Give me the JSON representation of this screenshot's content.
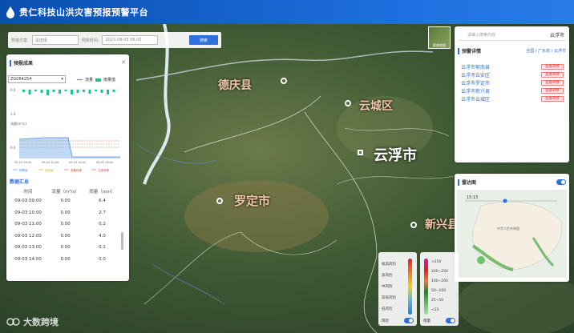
{
  "header": {
    "title": "贵仁科技山洪灾害预报预警平台"
  },
  "search": {
    "field1_label": "预报方案:",
    "field1_value": "请选择",
    "field2_label": "预报时间:",
    "field2_value": "2023-09-03 09:00",
    "button": "搜索"
  },
  "thumb_label": "影像地图",
  "map_labels": {
    "city1": "德庆县",
    "city2": "云城区",
    "city3": "云浮市",
    "city4": "罗定市",
    "city5": "新兴县"
  },
  "left_panel": {
    "title": "预报成果",
    "station": "ZG064254",
    "legend_flow": "流量",
    "legend_rain": "雨量值",
    "y_top": [
      "0.0",
      "1.4"
    ],
    "y_flow": [
      "0.0",
      "0.0"
    ],
    "flow_label": "流量(m³/s)",
    "x_ticks": [
      "09-03 09:00",
      "09-03 12:00",
      "09-03 15:00",
      "09-03 18:00"
    ],
    "thresholds": [
      "预警值",
      "危险值",
      "准备转移",
      "立即转移"
    ],
    "summary_title": "数据汇总",
    "columns": [
      "时间",
      "流量（m³/s）",
      "雨量（mm）"
    ],
    "rows": [
      [
        "09-03 09:00",
        "0.00",
        "6.4"
      ],
      [
        "09-03 10:00",
        "0.00",
        "2.7"
      ],
      [
        "09-03 11:00",
        "0.00",
        "0.2"
      ],
      [
        "09-03 12:00",
        "0.00",
        "4.0"
      ],
      [
        "09-03 13:00",
        "0.00",
        "0.1"
      ],
      [
        "09-03 14:00",
        "0.00",
        "0.0"
      ]
    ]
  },
  "right_panel": {
    "search_placeholder": "请输入搜索内容",
    "location": "云浮市",
    "title": "预警详情",
    "crumb": "全国 / 广东省 / 云浮市",
    "items": [
      [
        "云浮市郁南县",
        "准备转移"
      ],
      [
        "云浮市云安区",
        "准备转移"
      ],
      [
        "云浮市罗定市",
        "准备转移"
      ],
      [
        "云浮市新兴县",
        "准备转移"
      ],
      [
        "云浮市云城区",
        "准备转移"
      ]
    ]
  },
  "radar": {
    "title": "雷达图",
    "time": "15:15",
    "region_label": "中华人民共和国"
  },
  "legend_left": {
    "labels": [
      "极高风险",
      "高风险",
      "中风险",
      "较低风险",
      "低风险"
    ],
    "footer": "风险"
  },
  "legend_right": {
    "labels": [
      ">250",
      "200~250",
      "100~200",
      "50~100",
      "25~50",
      "<25"
    ],
    "footer": "雨量"
  },
  "watermark": "大数跨境",
  "colors": {
    "accent": "#2f6fe0",
    "warn": "#e03030",
    "rain": "#19c58a",
    "flow": "#4a90e2"
  }
}
